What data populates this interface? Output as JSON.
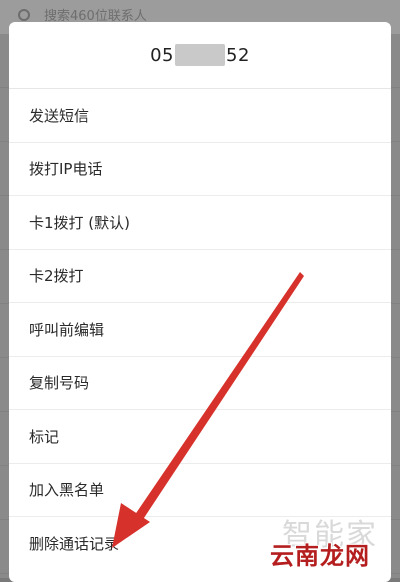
{
  "background": {
    "search_placeholder": "搜索460位联系人"
  },
  "dialog": {
    "phone_prefix": "05",
    "phone_suffix": "52",
    "menu": [
      {
        "label": "发送短信"
      },
      {
        "label": "拨打IP电话"
      },
      {
        "label": "卡1拨打 (默认)"
      },
      {
        "label": "卡2拨打"
      },
      {
        "label": "呼叫前编辑"
      },
      {
        "label": "复制号码"
      },
      {
        "label": "标记"
      },
      {
        "label": "加入黑名单"
      },
      {
        "label": "删除通话记录"
      }
    ]
  },
  "annotation": {
    "arrow_color": "#d6322b",
    "arrow_target": "删除通话记录"
  },
  "watermark": {
    "top_text": "智能家",
    "bottom_text": "云南龙网"
  }
}
